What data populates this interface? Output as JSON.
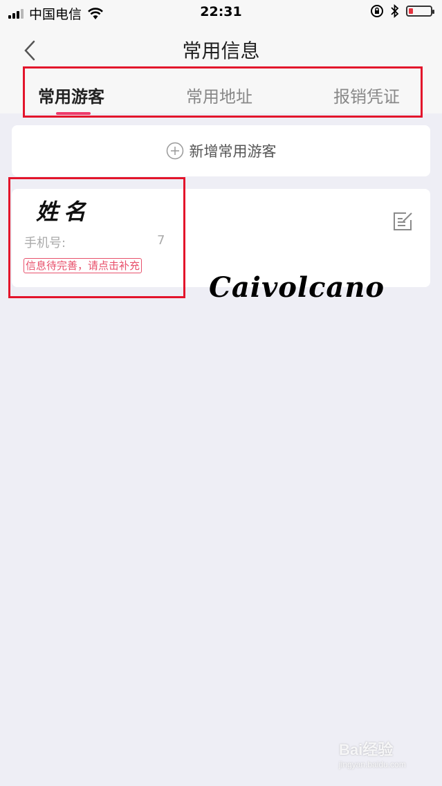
{
  "status_bar": {
    "carrier": "中国电信",
    "time": "22:31",
    "icons": [
      "signal-icon",
      "wifi-icon",
      "orientation-lock-icon",
      "bluetooth-icon",
      "battery-icon"
    ]
  },
  "nav": {
    "title": "常用信息",
    "back_icon": "chevron-left-icon"
  },
  "tabs": [
    {
      "label": "常用游客",
      "active": true
    },
    {
      "label": "常用地址",
      "active": false
    },
    {
      "label": "报销凭证",
      "active": false
    }
  ],
  "add_guest": {
    "label": "新增常用游客",
    "icon": "plus-circle-icon"
  },
  "guest": {
    "name": "姓名",
    "phone_label": "手机号:",
    "phone_value": "7",
    "warning": "信息待完善，请点击补充",
    "edit_icon": "edit-icon"
  },
  "watermark": {
    "signature": "Caivolcano",
    "brand": "Bai经验",
    "site": "jingyan.baidu.com"
  },
  "colors": {
    "accent": "#ee3a6a",
    "highlight_box": "#e3142b",
    "background": "#eeeef5",
    "warning": "#e8506b"
  }
}
